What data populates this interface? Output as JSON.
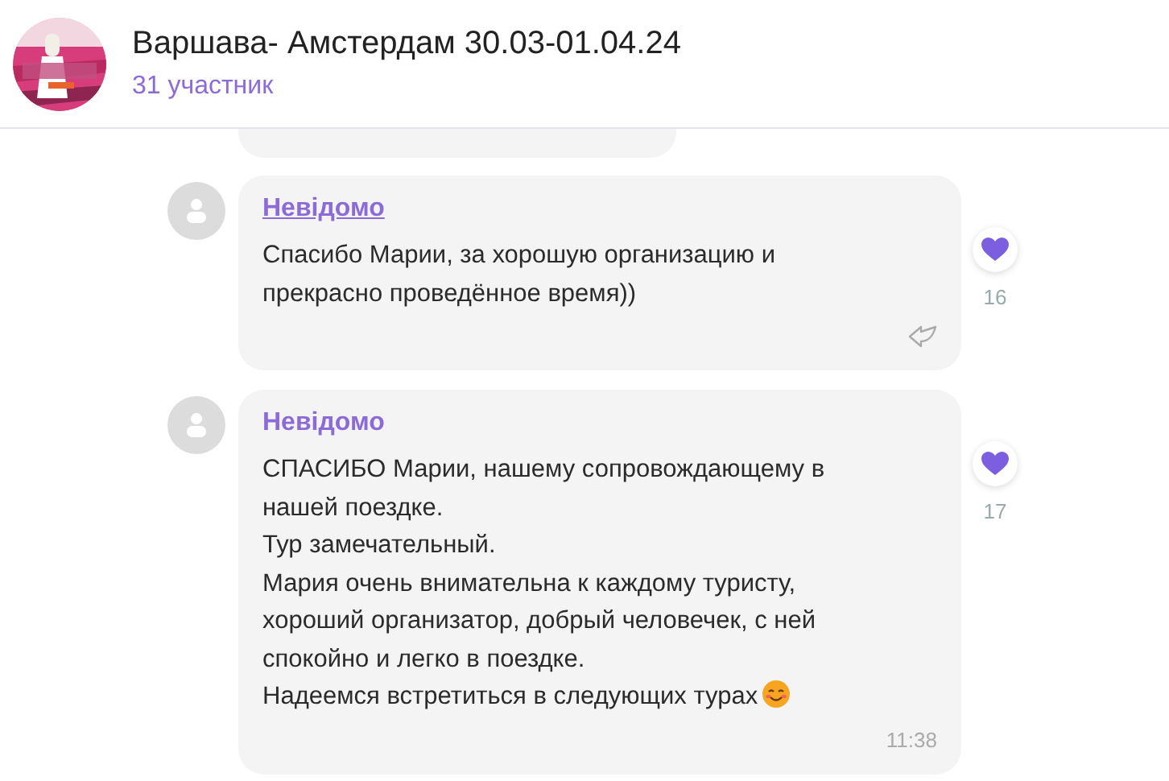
{
  "header": {
    "title": "Варшава- Амстердам 30.03-01.04.24",
    "subtitle": "31 участник"
  },
  "messages": [
    {
      "sender": "Невідомо",
      "underlined": true,
      "text": "Спасибо Марии, за хорошую организацию и\nпрекрасно проведённое время))",
      "trailing_emoji": false,
      "footer": {
        "kind": "reply"
      },
      "reaction": {
        "count": "16"
      }
    },
    {
      "sender": "Невідомо",
      "underlined": false,
      "text": "СПАСИБО Марии, нашему сопровождающему в\nнашей поездке.\nТур замечательный.\nМария очень внимательна к каждому туристу,\nхороший организатор, добрый человечек,  с ней\nспокойно и легко в поездке.\nНадеемся встретиться в следующих турах",
      "trailing_emoji": true,
      "footer": {
        "kind": "time",
        "time": "11:38"
      },
      "reaction": {
        "count": "17"
      }
    }
  ]
}
